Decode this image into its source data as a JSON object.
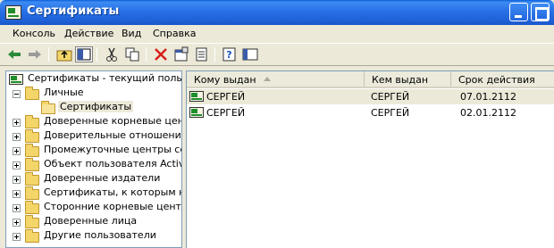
{
  "window": {
    "title": "Сертификаты"
  },
  "menu": [
    "Консоль",
    "Действие",
    "Вид",
    "Справка"
  ],
  "toolbar": {
    "icons": [
      "back-arrow-icon",
      "forward-arrow-icon",
      "up-folder-icon",
      "show-hide-tree-icon",
      "cut-icon",
      "copy-icon",
      "delete-icon",
      "properties-icon",
      "export-list-icon",
      "help-icon",
      "description-icon"
    ]
  },
  "tree": {
    "root": "Сертификаты - текущий пользова",
    "items": [
      {
        "label": "Личные",
        "expanded": true
      },
      {
        "label": "Сертификаты",
        "selected": true
      },
      {
        "label": "Доверенные корневые центры"
      },
      {
        "label": "Доверительные отношения в"
      },
      {
        "label": "Промежуточные центры серти"
      },
      {
        "label": "Объект пользователя Active D"
      },
      {
        "label": "Доверенные издатели"
      },
      {
        "label": "Сертификаты, к которым нет"
      },
      {
        "label": "Сторонние корневые центры с"
      },
      {
        "label": "Доверенные лица"
      },
      {
        "label": "Другие пользователи"
      }
    ]
  },
  "list": {
    "columns": [
      "Кому выдан",
      "Кем выдан",
      "Срок действия"
    ],
    "rows": [
      {
        "issued_to": "СЕРГЕЙ",
        "issued_by": "СЕРГЕЙ",
        "expires": "07.01.2112"
      },
      {
        "issued_to": "СЕРГЕЙ",
        "issued_by": "СЕРГЕЙ",
        "expires": "02.01.2112"
      }
    ]
  }
}
